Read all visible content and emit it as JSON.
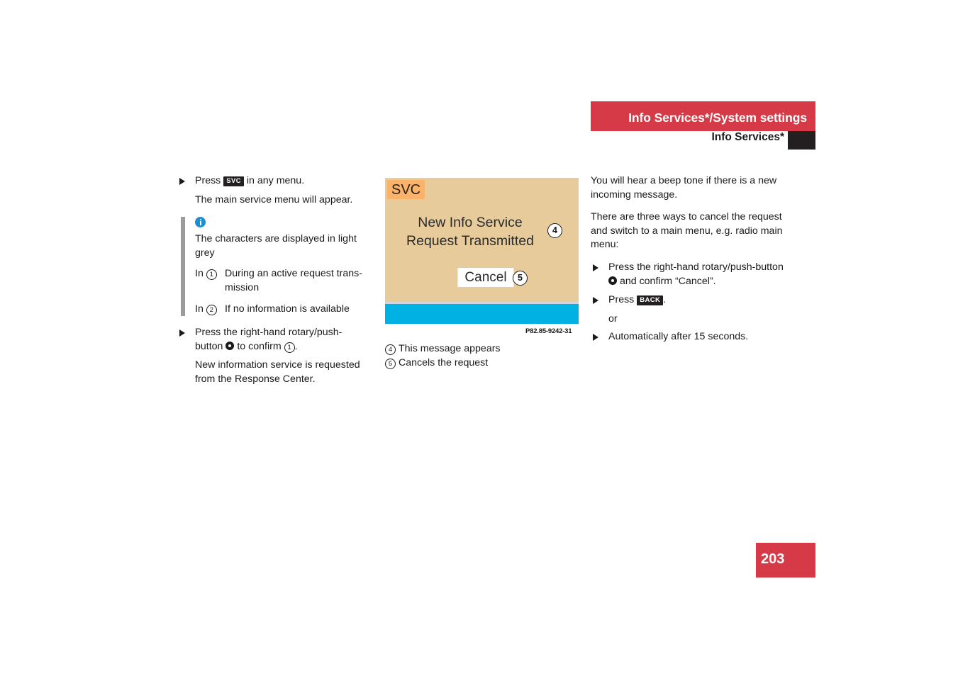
{
  "header": {
    "chapter_title": "Info Services*/System settings",
    "section_title": "Info Services*",
    "band_color": "#d73a47",
    "tab_color": "#231f20"
  },
  "page_number": "203",
  "left_column": {
    "step_1": {
      "prefix": "Press",
      "keycap": "SVC",
      "suffix": "in any menu."
    },
    "step_1_result": "The main service menu will appear.",
    "note": {
      "icon": "info-icon",
      "text": "The characters are displayed in light grey",
      "rows": [
        {
          "key_prefix": "In",
          "key_num": "1",
          "value": "During an active request trans-mission"
        },
        {
          "key_prefix": "In",
          "key_num": "2",
          "value": "If no information is available"
        }
      ]
    },
    "step_2": {
      "text_a": "Press the right-hand rotary/push-button",
      "rotary_icon": "rotary-push-button-icon",
      "text_b": "to confirm",
      "ref_num": "1",
      "text_c": "."
    },
    "step_2_result": "New information service is requested from the Response Center."
  },
  "figure": {
    "screen": {
      "tab_label": "SVC",
      "message_line_1": "New Info Service",
      "message_line_2": "Request Transmitted",
      "cancel_label": "Cancel",
      "background_color": "#e8cb9a",
      "tab_color": "#f9b36a",
      "status_bar_color": "#00b2e3"
    },
    "callouts": [
      {
        "num": "4"
      },
      {
        "num": "5"
      }
    ],
    "image_code": "P82.85-9242-31",
    "legend": [
      {
        "num": "4",
        "text": "This message appears"
      },
      {
        "num": "5",
        "text": "Cancels the request"
      }
    ]
  },
  "right_column": {
    "para_1": "You will hear a beep tone if there is a new incoming message.",
    "para_2": "There are three ways to cancel the request and switch to a main menu, e.g. radio main menu:",
    "bullet_1": {
      "text_a": "Press the right-hand rotary/push-button",
      "rotary_icon": "rotary-push-button-icon",
      "text_b": "and confirm “Cancel”."
    },
    "bullet_2": {
      "prefix": "Press",
      "keycap": "BACK",
      "suffix": "."
    },
    "or_label": "or",
    "bullet_3": "Automatically after 15 seconds."
  }
}
